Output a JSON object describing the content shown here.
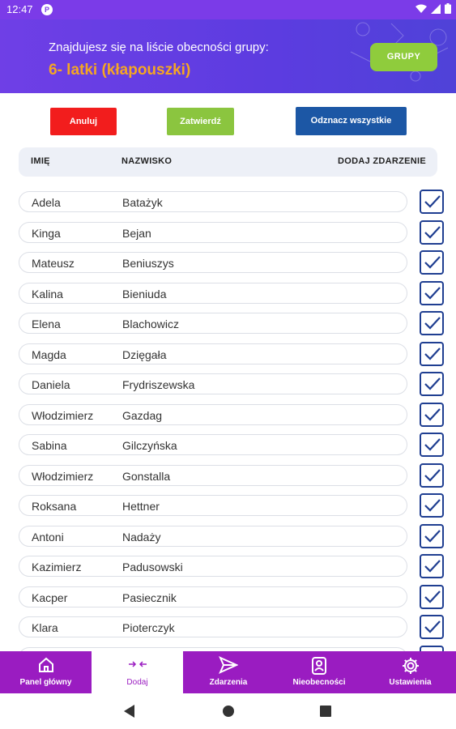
{
  "status_bar": {
    "time": "12:47",
    "notification_badge": "P"
  },
  "header": {
    "subtitle": "Znajdujesz się na liście obecności grupy:",
    "group_name": "6- latki (kłapouszki)",
    "groups_button": "GRUPY"
  },
  "actions": {
    "cancel": "Anuluj",
    "confirm": "Zatwierdź",
    "uncheck_all": "Odznacz wszystkie"
  },
  "table": {
    "columns": [
      "IMIĘ",
      "NAZWISKO",
      "DODAJ ZDARZENIE"
    ],
    "rows": [
      {
        "first": "Adela",
        "last": "Batażyk",
        "checked": true
      },
      {
        "first": "Kinga",
        "last": "Bejan",
        "checked": true
      },
      {
        "first": "Mateusz",
        "last": "Beniuszys",
        "checked": true
      },
      {
        "first": "Kalina",
        "last": "Bieniuda",
        "checked": true
      },
      {
        "first": "Elena",
        "last": "Blachowicz",
        "checked": true
      },
      {
        "first": "Magda",
        "last": "Dzięgała",
        "checked": true
      },
      {
        "first": "Daniela",
        "last": "Frydriszewska",
        "checked": true
      },
      {
        "first": "Włodzimierz",
        "last": "Gazdag",
        "checked": true
      },
      {
        "first": "Sabina",
        "last": "Gilczyńska",
        "checked": true
      },
      {
        "first": "Włodzimierz",
        "last": "Gonstalla",
        "checked": true
      },
      {
        "first": "Roksana",
        "last": "Hettner",
        "checked": true
      },
      {
        "first": "Antoni",
        "last": "Nadaży",
        "checked": true
      },
      {
        "first": "Kazimierz",
        "last": "Padusowski",
        "checked": true
      },
      {
        "first": "Kacper",
        "last": "Pasiecznik",
        "checked": true
      },
      {
        "first": "Klara",
        "last": "Pioterczyk",
        "checked": true
      },
      {
        "first": "",
        "last": "",
        "checked": true
      }
    ]
  },
  "bottom_nav": [
    {
      "label": "Panel główny",
      "icon": "home-icon",
      "active": false
    },
    {
      "label": "Dodaj",
      "icon": "add-arrows-icon",
      "active": true
    },
    {
      "label": "Zdarzenia",
      "icon": "send-icon",
      "active": false
    },
    {
      "label": "Nieobecności",
      "icon": "absence-badge-icon",
      "active": false
    },
    {
      "label": "Ustawienia",
      "icon": "gear-icon",
      "active": false
    }
  ],
  "colors": {
    "header_bg": "#6f3fe6",
    "group_name": "#f5a623",
    "groups_button": "#8fcc3c",
    "cancel": "#f21d1d",
    "confirm": "#8bc53f",
    "uncheck_all": "#1c57a5",
    "checkbox": "#1f3e91",
    "bottom_nav_bg": "#9a1cc1"
  }
}
